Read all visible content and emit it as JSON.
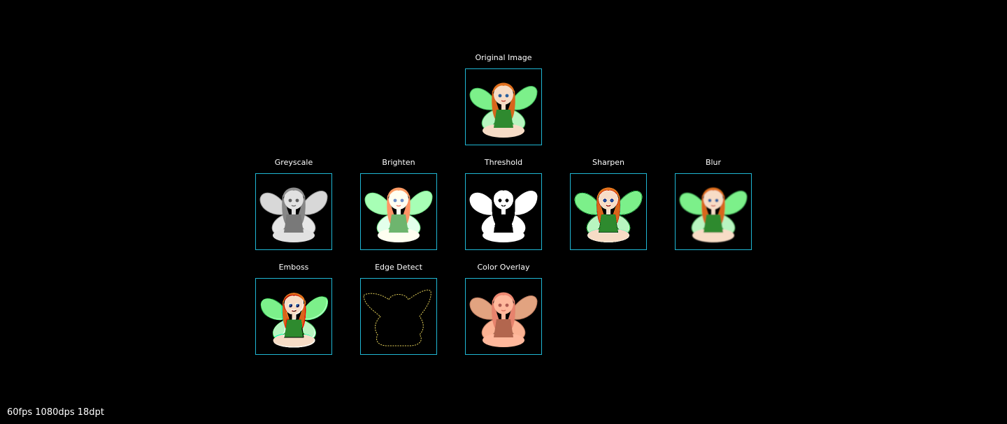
{
  "filters": [
    {
      "label": "Original Image",
      "icon": "fairy-original-thumbnail"
    },
    {
      "label": "Greyscale",
      "icon": "fairy-greyscale-thumbnail"
    },
    {
      "label": "Brighten",
      "icon": "fairy-brighten-thumbnail"
    },
    {
      "label": "Threshold",
      "icon": "fairy-threshold-thumbnail"
    },
    {
      "label": "Sharpen",
      "icon": "fairy-sharpen-thumbnail"
    },
    {
      "label": "Blur",
      "icon": "fairy-blur-thumbnail"
    },
    {
      "label": "Emboss",
      "icon": "fairy-emboss-thumbnail"
    },
    {
      "label": "Edge Detect",
      "icon": "fairy-edge-detect-thumbnail"
    },
    {
      "label": "Color Overlay",
      "icon": "fairy-color-overlay-thumbnail"
    }
  ],
  "hud": {
    "stats": "60fps 1080dps 18dpt"
  },
  "colors": {
    "frame_border": "#1fb7d4",
    "background": "#000000"
  }
}
